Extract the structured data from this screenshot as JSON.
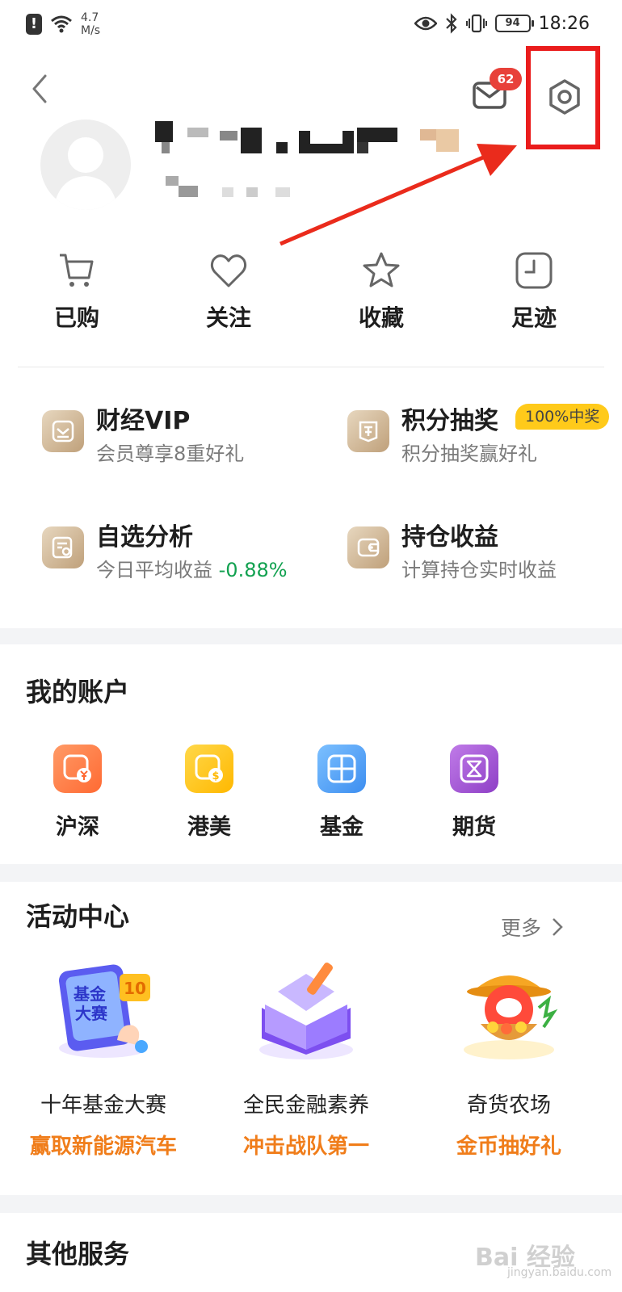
{
  "status_bar": {
    "alert_icon": "!",
    "net_speed_value": "4.7",
    "net_speed_unit": "M/s",
    "battery": "94",
    "time": "18:26"
  },
  "header": {
    "mail_badge": "62"
  },
  "quick_nav": [
    {
      "label": "已购",
      "icon": "cart-icon"
    },
    {
      "label": "关注",
      "icon": "heart-icon"
    },
    {
      "label": "收藏",
      "icon": "star-icon"
    },
    {
      "label": "足迹",
      "icon": "clock-icon"
    }
  ],
  "features": [
    {
      "title": "财经VIP",
      "subtitle": "会员尊享8重好礼",
      "icon": "vip-icon"
    },
    {
      "title": "积分抽奖",
      "subtitle": "积分抽奖赢好礼",
      "badge": "100%中奖",
      "icon": "lottery-icon"
    },
    {
      "title": "自选分析",
      "subtitle_prefix": "今日平均收益 ",
      "subtitle_value": "-0.88%",
      "icon": "analysis-icon"
    },
    {
      "title": "持仓收益",
      "subtitle": "计算持仓实时收益",
      "icon": "wallet-icon"
    }
  ],
  "accounts": {
    "title": "我的账户",
    "items": [
      {
        "label": "沪深",
        "color": "#ff7a45",
        "icon": "yuan-icon"
      },
      {
        "label": "港美",
        "color": "#ffc21a",
        "icon": "dollar-icon"
      },
      {
        "label": "基金",
        "color": "#4a9cf5",
        "icon": "fund-grid-icon"
      },
      {
        "label": "期货",
        "color": "#9a4fd0",
        "icon": "hourglass-icon"
      }
    ]
  },
  "activity": {
    "title": "活动中心",
    "more": "更多",
    "items": [
      {
        "name": "十年基金大赛",
        "promo": "赢取新能源汽车",
        "art_text_1": "基金",
        "art_text_2": "大赛",
        "art_badge": "10"
      },
      {
        "name": "全民金融素养",
        "promo": "冲击战队第一"
      },
      {
        "name": "奇货农场",
        "promo": "金币抽好礼"
      }
    ]
  },
  "other": {
    "title": "其他服务"
  },
  "watermark": {
    "text": "Bai 经验",
    "sub": "jingyan.baidu.com"
  }
}
